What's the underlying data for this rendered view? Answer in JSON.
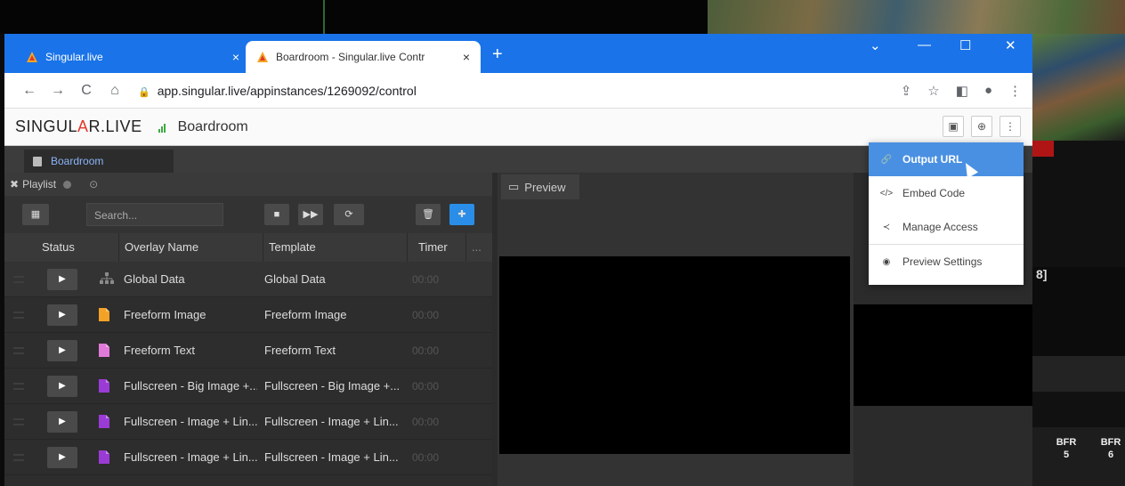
{
  "browser": {
    "tabs": [
      {
        "title": "Singular.live",
        "close": "×"
      },
      {
        "title": "Boardroom - Singular.live Contr",
        "close": "×"
      }
    ],
    "new_tab": "+",
    "window_controls": [
      "⌄",
      "—",
      "☐",
      "✕"
    ],
    "url": "app.singular.live/appinstances/1269092/control",
    "nav": [
      "←",
      "→",
      "C",
      "⌂"
    ]
  },
  "app": {
    "logo_prefix": "SINGUL",
    "logo_a": "A",
    "logo_suffix": "R.LIVE",
    "name": "Boardroom",
    "workspace_tab": "Boardroom"
  },
  "playlist": {
    "tab_label": "Playlist",
    "search_placeholder": "Search...",
    "columns": {
      "status": "Status",
      "name": "Overlay Name",
      "template": "Template",
      "timer": "Timer",
      "more": "..."
    },
    "rows": [
      {
        "name": "Global Data",
        "template": "Global Data",
        "timer": "00:00",
        "icon": "network-icon",
        "color": "#8a8a8a"
      },
      {
        "name": "Freeform Image",
        "template": "Freeform Image",
        "timer": "00:00",
        "icon": "file-icon",
        "color": "#f2a227"
      },
      {
        "name": "Freeform Text",
        "template": "Freeform Text",
        "timer": "00:00",
        "icon": "file-icon",
        "color": "#e07ad9"
      },
      {
        "name": "Fullscreen - Big Image +...",
        "template": "Fullscreen - Big Image +...",
        "timer": "00:00",
        "icon": "file-icon",
        "color": "#9b3bd6"
      },
      {
        "name": "Fullscreen - Image + Lin...",
        "template": "Fullscreen - Image + Lin...",
        "timer": "00:00",
        "icon": "file-icon",
        "color": "#9b3bd6"
      },
      {
        "name": "Fullscreen - Image + Lin...",
        "template": "Fullscreen - Image + Lin...",
        "timer": "00:00",
        "icon": "file-icon",
        "color": "#9b3bd6"
      }
    ]
  },
  "preview": {
    "tab_label": "Preview"
  },
  "menu": {
    "items": [
      {
        "label": "Output URL",
        "icon": "link-icon"
      },
      {
        "label": "Embed Code",
        "icon": "code-icon"
      },
      {
        "label": "Manage Access",
        "icon": "share-icon"
      },
      {
        "label": "Preview Settings",
        "icon": "eye-icon"
      }
    ]
  },
  "background": {
    "right_number": "8]",
    "bfr": [
      {
        "label": "BFR",
        "num": "5"
      },
      {
        "label": "BFR",
        "num": "6"
      }
    ]
  },
  "colors": {
    "browser_blue": "#1a73e8",
    "menu_active": "#4a90e2",
    "logo_accent": "#e0382a",
    "link_blue": "#8ab4f8"
  }
}
